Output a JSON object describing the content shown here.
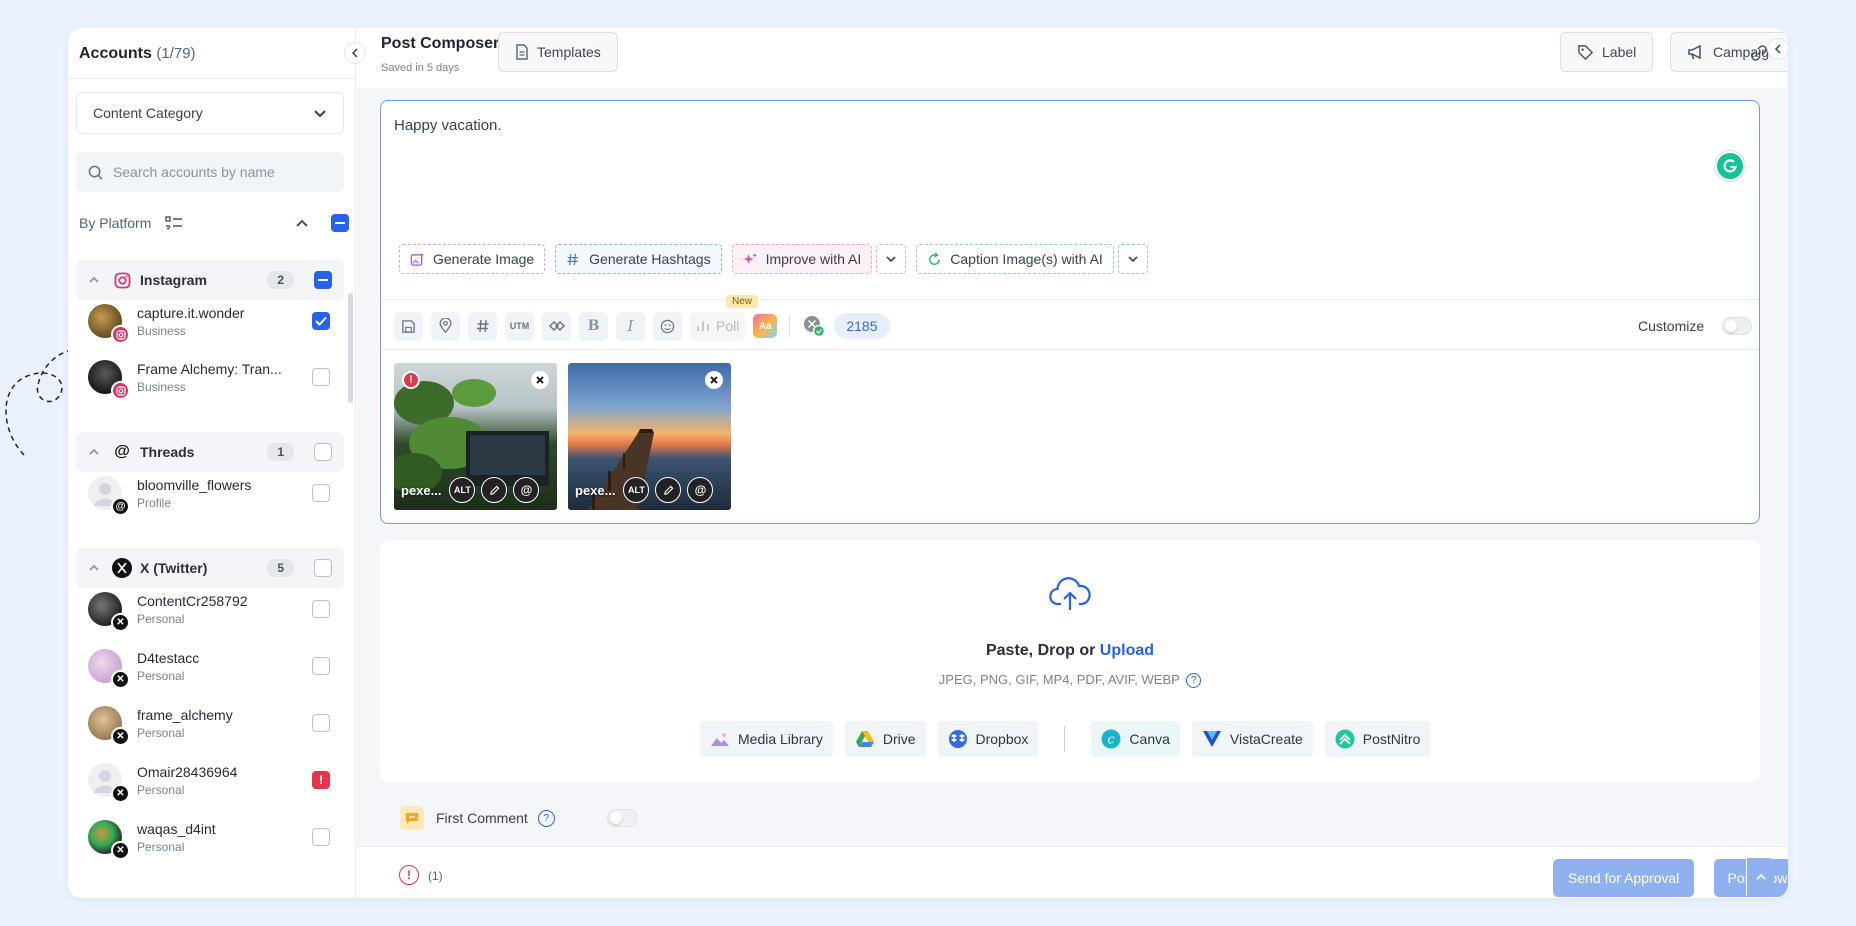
{
  "sidebar": {
    "title": "Accounts",
    "count": "(1/79)",
    "category_select": "Content Category",
    "search_placeholder": "Search accounts by name",
    "by_platform_label": "By Platform",
    "groups": {
      "instagram": {
        "name": "Instagram",
        "count": "2"
      },
      "threads": {
        "name": "Threads",
        "count": "1"
      },
      "twitter": {
        "name": "X (Twitter)",
        "count": "5"
      }
    },
    "accounts": [
      {
        "name": "capture.it.wonder",
        "type": "Business",
        "platform": "instagram",
        "checked": true
      },
      {
        "name": "Frame Alchemy: Tran...",
        "type": "Business",
        "platform": "instagram",
        "checked": false
      },
      {
        "name": "bloomville_flowers",
        "type": "Profile",
        "platform": "threads",
        "checked": false
      },
      {
        "name": "ContentCr258792",
        "type": "Personal",
        "platform": "twitter",
        "checked": false
      },
      {
        "name": "D4testacc",
        "type": "Personal",
        "platform": "twitter",
        "checked": false
      },
      {
        "name": "frame_alchemy",
        "type": "Personal",
        "platform": "twitter",
        "checked": false
      },
      {
        "name": "Omair28436964",
        "type": "Personal",
        "platform": "twitter",
        "error": true
      },
      {
        "name": "waqas_d4int",
        "type": "Personal",
        "platform": "twitter",
        "checked": false
      }
    ]
  },
  "header": {
    "title": "Post Composer",
    "subtitle": "Saved in 5 days",
    "templates_label": "Templates",
    "label_button": "Label",
    "campaign_button": "Campaign"
  },
  "editor": {
    "text": "Happy vacation.",
    "ai_actions": {
      "generate_image": "Generate Image",
      "generate_hashtags": "Generate Hashtags",
      "improve_ai": "Improve with AI",
      "caption_images": "Caption Image(s) with AI"
    },
    "toolbar": {
      "utm": "UTM",
      "poll": "Poll",
      "new_badge": "New",
      "aa": "Aa",
      "char_count": "2185",
      "customize": "Customize"
    },
    "media": [
      {
        "name": "pexe...",
        "alt": "ALT",
        "has_warning": true
      },
      {
        "name": "pexe...",
        "alt": "ALT",
        "has_warning": false
      }
    ]
  },
  "upload": {
    "title_prefix": "Paste, Drop or ",
    "title_link": "Upload",
    "formats": "JPEG, PNG, GIF, MP4, PDF, AVIF, WEBP",
    "help": "?",
    "sources": {
      "media_library": "Media Library",
      "drive": "Drive",
      "dropbox": "Dropbox",
      "canva": "Canva",
      "vistacreate": "VistaCreate",
      "postnitro": "PostNitro"
    }
  },
  "first_comment": {
    "label": "First Comment",
    "help": "?"
  },
  "footer": {
    "warning_icon": "!",
    "warning_count": "(1)",
    "send_approval": "Send for Approval",
    "post_now": "Post Now"
  },
  "colors": {
    "accent": "#2563eb",
    "instagram": "#e1306c",
    "error": "#e5354b",
    "grammarly": "#15c39a"
  }
}
